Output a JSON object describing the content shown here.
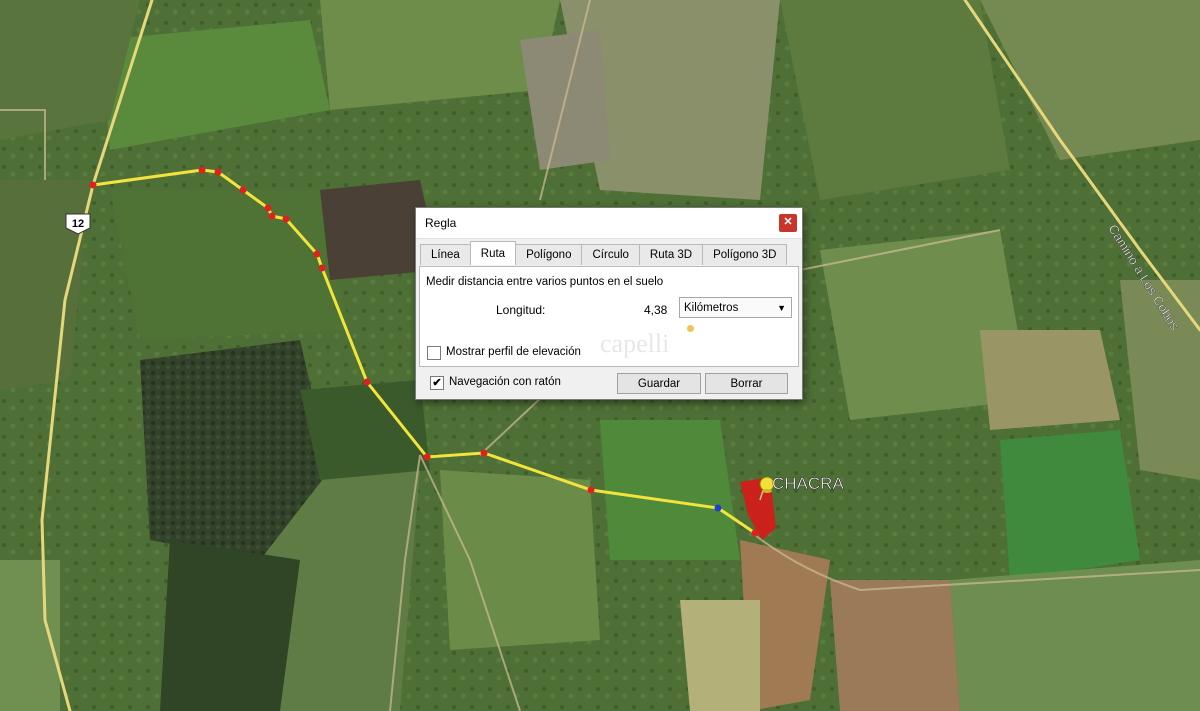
{
  "map": {
    "road_shield": "12",
    "road_name": "Camino a Los Cobos",
    "placemark_label": "CHACRA",
    "pin_icon": "yellow-pushpin-icon",
    "colors": {
      "route": "#f0e23a",
      "route_point": "#e02020",
      "selected_point": "#2040d0",
      "parcel": "#e01515",
      "road": "#e6d77a"
    }
  },
  "dialog": {
    "title": "Regla",
    "close_icon": "close-icon",
    "tabs": [
      {
        "label": "Línea"
      },
      {
        "label": "Ruta",
        "active": true
      },
      {
        "label": "Polígono"
      },
      {
        "label": "Círculo"
      },
      {
        "label": "Ruta 3D"
      },
      {
        "label": "Polígono 3D"
      }
    ],
    "description": "Medir distancia entre varios puntos en el suelo",
    "length_label": "Longitud:",
    "length_value": "4,38",
    "unit": "Kilómetros",
    "show_elevation_label": "Mostrar perfil de elevación",
    "show_elevation_checked": false,
    "mouse_nav_label": "Navegación con ratón",
    "mouse_nav_checked": true,
    "save_label": "Guardar",
    "clear_label": "Borrar",
    "watermark": "capelli"
  }
}
